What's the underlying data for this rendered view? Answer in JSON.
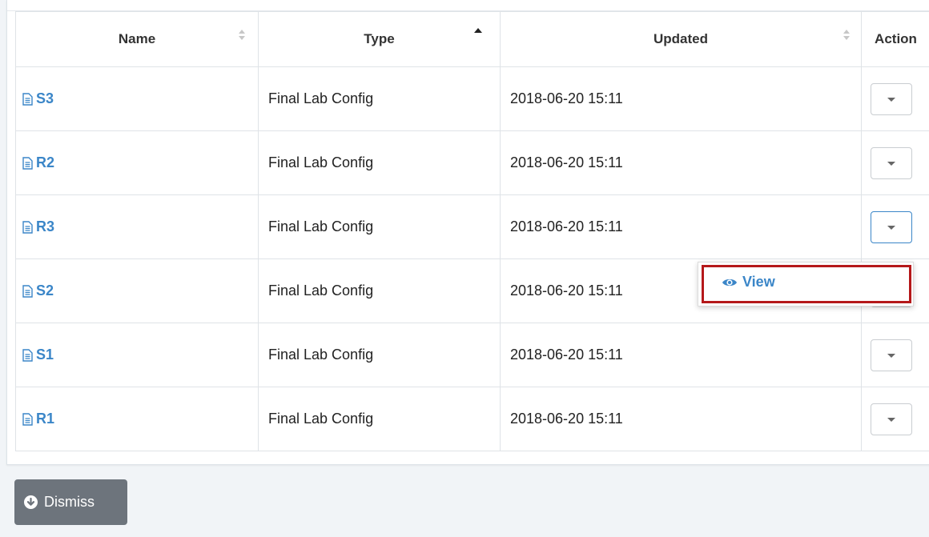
{
  "table": {
    "headers": {
      "name": "Name",
      "type": "Type",
      "updated": "Updated",
      "action": "Action"
    },
    "rows": [
      {
        "name": "S3",
        "type": "Final Lab Config",
        "updated": "2018-06-20 15:11"
      },
      {
        "name": "R2",
        "type": "Final Lab Config",
        "updated": "2018-06-20 15:11"
      },
      {
        "name": "R3",
        "type": "Final Lab Config",
        "updated": "2018-06-20 15:11"
      },
      {
        "name": "S2",
        "type": "Final Lab Config",
        "updated": "2018-06-20 15:11"
      },
      {
        "name": "S1",
        "type": "Final Lab Config",
        "updated": "2018-06-20 15:11"
      },
      {
        "name": "R1",
        "type": "Final Lab Config",
        "updated": "2018-06-20 15:11"
      }
    ]
  },
  "dropdown": {
    "view_label": "View"
  },
  "footer": {
    "dismiss_label": "Dismiss"
  },
  "colors": {
    "link": "#3b86c8",
    "highlight": "#b5181a",
    "dismiss_bg": "#6d747c"
  },
  "icons": {
    "row_icon": "document-icon",
    "view_icon": "eye-icon",
    "dismiss_icon": "arrow-circle-down-icon"
  }
}
